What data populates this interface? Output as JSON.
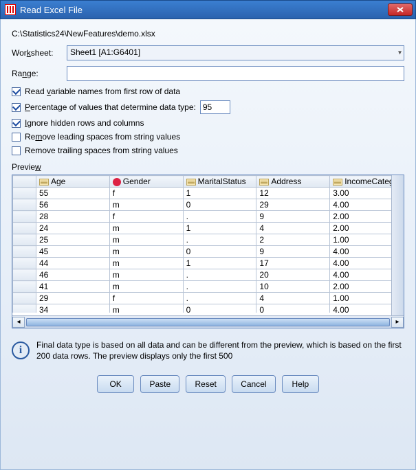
{
  "window": {
    "title": "Read Excel File"
  },
  "filepath": "C:\\Statistics24\\NewFeatures\\demo.xlsx",
  "worksheet": {
    "label_pre": "Wor",
    "label_accel": "k",
    "label_post": "sheet:",
    "value": "Sheet1 [A1:G6401]"
  },
  "range": {
    "label_pre": "Ra",
    "label_accel": "n",
    "label_post": "ge:",
    "value": ""
  },
  "options": {
    "read_varnames": {
      "checked": true,
      "label_pre": "Read ",
      "label_accel": "v",
      "label_post": "ariable names from first row of data"
    },
    "pct_determine": {
      "checked": true,
      "label_pre": "",
      "label_accel": "P",
      "label_post": "ercentage of values that determine data type:",
      "value": "95"
    },
    "ignore_hidden": {
      "checked": true,
      "label_pre": "",
      "label_accel": "I",
      "label_post": "gnore hidden rows and columns"
    },
    "remove_leading": {
      "checked": false,
      "label_pre": "Re",
      "label_accel": "m",
      "label_post": "ove leading spaces from string values"
    },
    "remove_trailing": {
      "checked": false,
      "label_pre": "Remove trailin",
      "label_accel": "g",
      "label_post": " spaces from string values"
    }
  },
  "preview": {
    "label_pre": "Previe",
    "label_accel": "w",
    "columns": [
      {
        "name": "Age",
        "icon": "ruler"
      },
      {
        "name": "Gender",
        "icon": "nominal"
      },
      {
        "name": "MaritalStatus",
        "icon": "ruler"
      },
      {
        "name": "Address",
        "icon": "ruler"
      },
      {
        "name": "IncomeCategory",
        "icon": "ruler"
      }
    ],
    "rows": [
      [
        "55",
        "f",
        "1",
        "12",
        "3.00"
      ],
      [
        "56",
        "m",
        "0",
        "29",
        "4.00"
      ],
      [
        "28",
        " f",
        ".",
        "9",
        "2.00"
      ],
      [
        "24",
        "m",
        "1",
        "4",
        "2.00"
      ],
      [
        "25",
        "   m",
        ".",
        "2",
        "1.00"
      ],
      [
        "45",
        "m",
        "0",
        "9",
        "4.00"
      ],
      [
        "44",
        "m",
        "1",
        "17",
        "4.00"
      ],
      [
        "46",
        "m",
        ".",
        "20",
        "4.00"
      ],
      [
        "41",
        "m",
        ".",
        "10",
        "2.00"
      ],
      [
        "29",
        "f",
        ".",
        "4",
        "1.00"
      ],
      [
        "34",
        "m",
        "0",
        "0",
        "4.00"
      ]
    ]
  },
  "info": "Final data type is based on all data and can be different from the preview, which is based on the first 200 data rows. The preview displays only the first 500",
  "buttons": {
    "ok": "OK",
    "paste": "Paste",
    "reset": "Reset",
    "cancel": "Cancel",
    "help": "Help"
  }
}
